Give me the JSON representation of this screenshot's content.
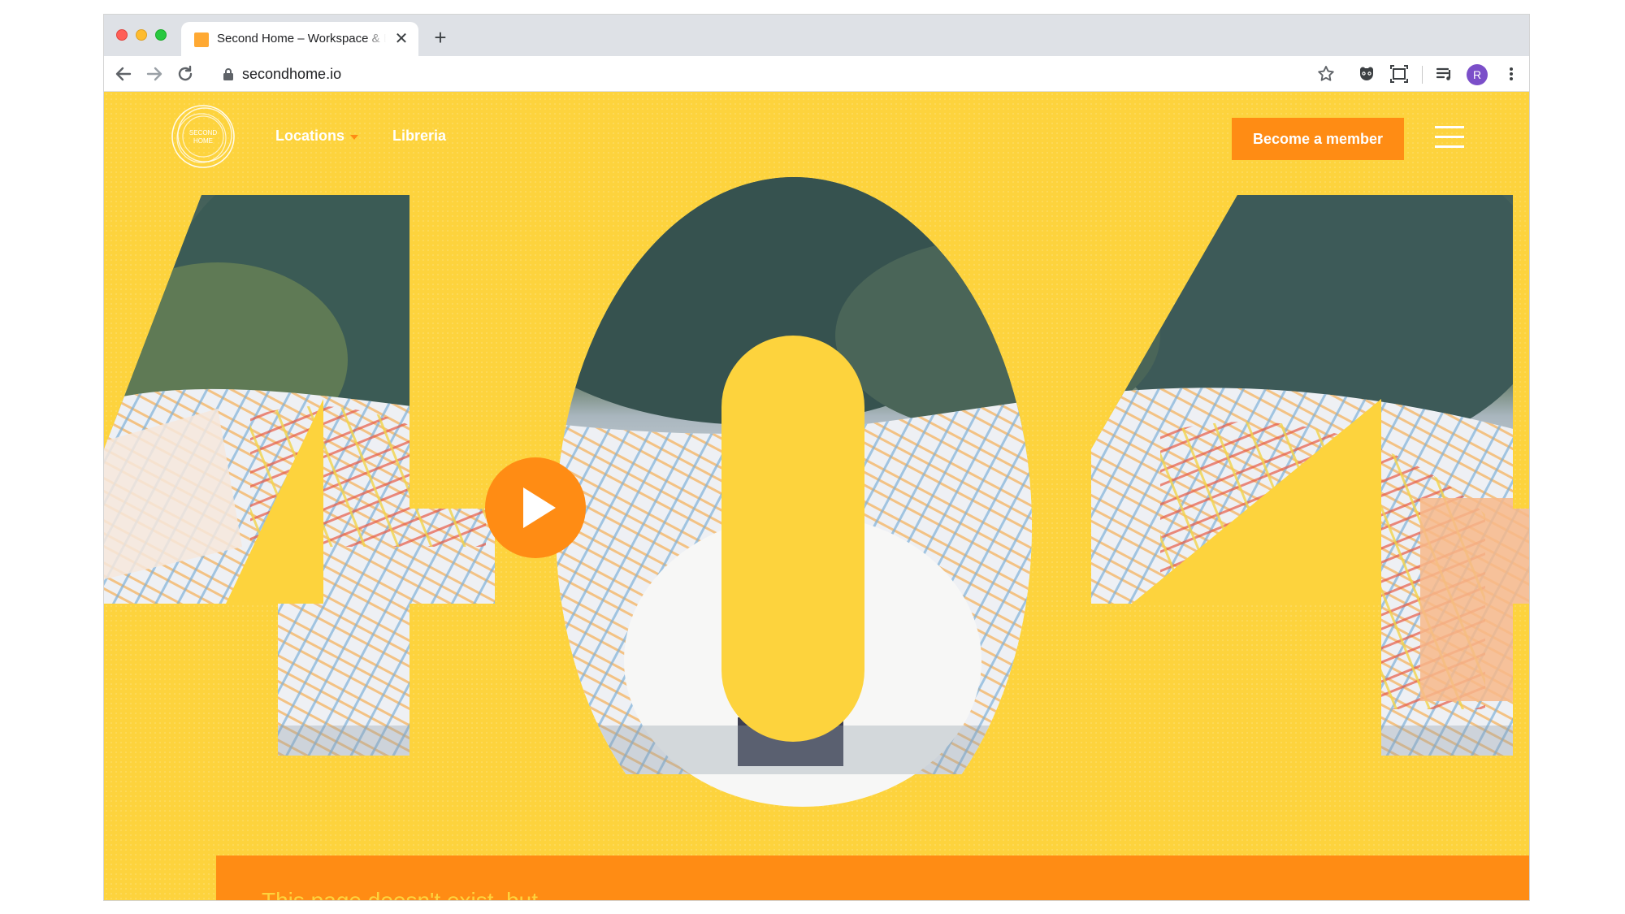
{
  "browser": {
    "tab_title": "Second Home – Workspace & Events",
    "tab_close": "✕",
    "new_tab": "+",
    "url": "secondhome.io",
    "avatar_letter": "R"
  },
  "site": {
    "logo_text_line1": "SECOND",
    "logo_text_line2": "HOME",
    "nav": {
      "locations_label": "Locations",
      "libreria_label": "Libreria"
    },
    "cta_label": "Become a member",
    "error_code": "404",
    "bottom_text": "This page doesn't exist, but..."
  },
  "colors": {
    "page_yellow": "#fdd33d",
    "accent_orange": "#ff8c14",
    "avatar_purple": "#7b4fc9"
  },
  "icons": [
    "back-arrow-icon",
    "forward-arrow-icon",
    "reload-icon",
    "lock-icon",
    "bookmark-star-icon",
    "extension-icon",
    "screenshot-icon",
    "media-queue-icon",
    "kebab-menu-icon",
    "play-icon",
    "hamburger-menu-icon"
  ]
}
